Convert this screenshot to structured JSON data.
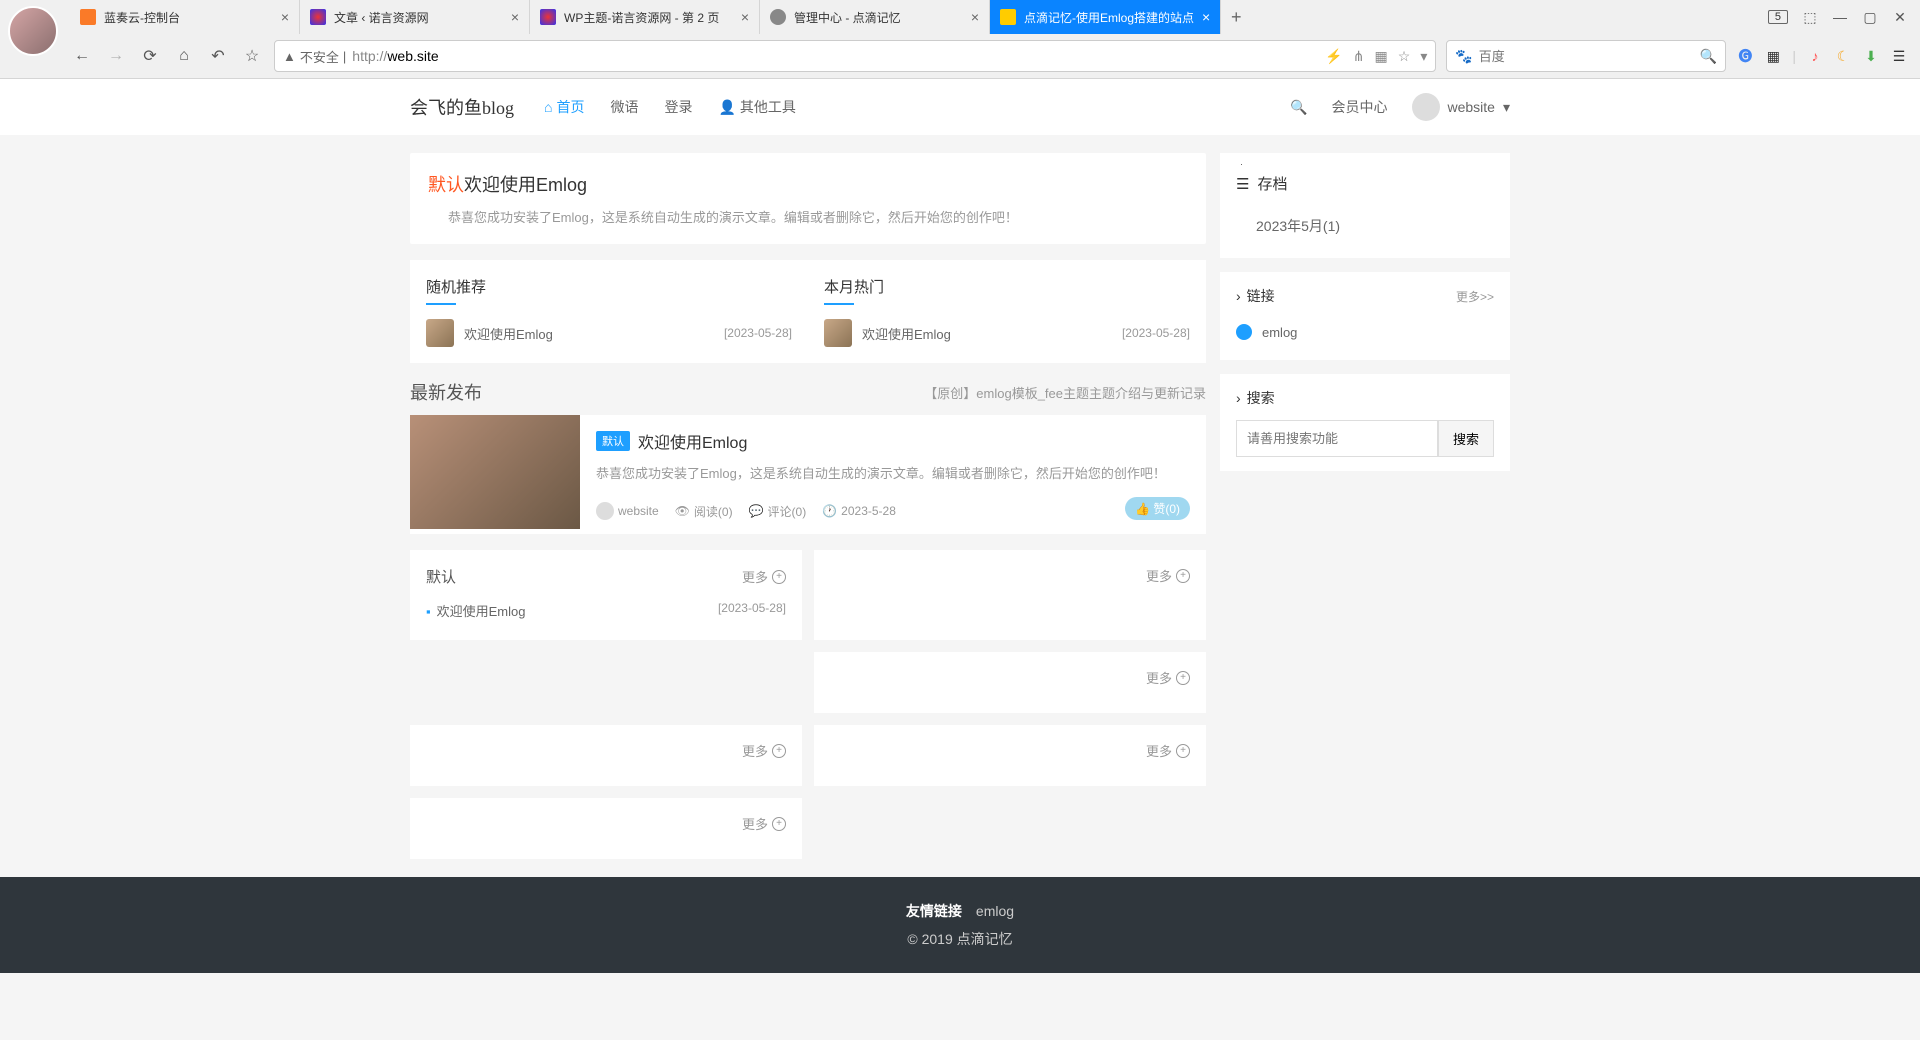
{
  "browser": {
    "tabs": [
      {
        "title": "蓝奏云-控制台"
      },
      {
        "title": "文章 ‹ 诺言资源网"
      },
      {
        "title": "WP主题-诺言资源网 - 第 2 页"
      },
      {
        "title": "管理中心 - 点滴记忆"
      },
      {
        "title": "点滴记忆-使用Emlog搭建的站点"
      }
    ],
    "badge": "5",
    "url_warn": "不安全",
    "url_prefix": "http://",
    "url_domain": "web.site",
    "search_placeholder": "百度"
  },
  "nav": {
    "logo": "会飞的鱼blog",
    "links": {
      "home": "首页",
      "weibo": "微语",
      "login": "登录",
      "tools": "其他工具"
    },
    "member": "会员中心",
    "user": "website"
  },
  "welcome": {
    "tag": "默认",
    "title": "欢迎使用Emlog",
    "desc": "恭喜您成功安装了Emlog，这是系统自动生成的演示文章。编辑或者删除它，然后开始您的创作吧！"
  },
  "recommend": {
    "title": "随机推荐",
    "item_title": "欢迎使用Emlog",
    "item_date": "[2023-05-28]"
  },
  "hot": {
    "title": "本月热门",
    "item_title": "欢迎使用Emlog",
    "item_date": "[2023-05-28]"
  },
  "latest": {
    "heading": "最新发布",
    "subtitle": "【原创】emlog模板_fee主题主题介绍与更新记录"
  },
  "post": {
    "tag": "默认",
    "title": "欢迎使用Emlog",
    "desc": "恭喜您成功安装了Emlog，这是系统自动生成的演示文章。编辑或者删除它，然后开始您的创作吧！",
    "author": "website",
    "read": "阅读(0)",
    "comment": "评论(0)",
    "date": "2023-5-28",
    "like": "赞(0)"
  },
  "category": {
    "title": "默认",
    "more": "更多",
    "item_title": "欢迎使用Emlog",
    "item_date": "[2023-05-28]"
  },
  "sidebar": {
    "archive_title": "存档",
    "archive_item": "2023年5月(1)",
    "links_title": "链接",
    "links_more": "更多>>",
    "link_item": "emlog",
    "search_title": "搜索",
    "search_placeholder": "请善用搜索功能",
    "search_btn": "搜索"
  },
  "footer": {
    "links_label": "友情链接",
    "link": "emlog",
    "copyright": "© 2019 点滴记忆"
  }
}
